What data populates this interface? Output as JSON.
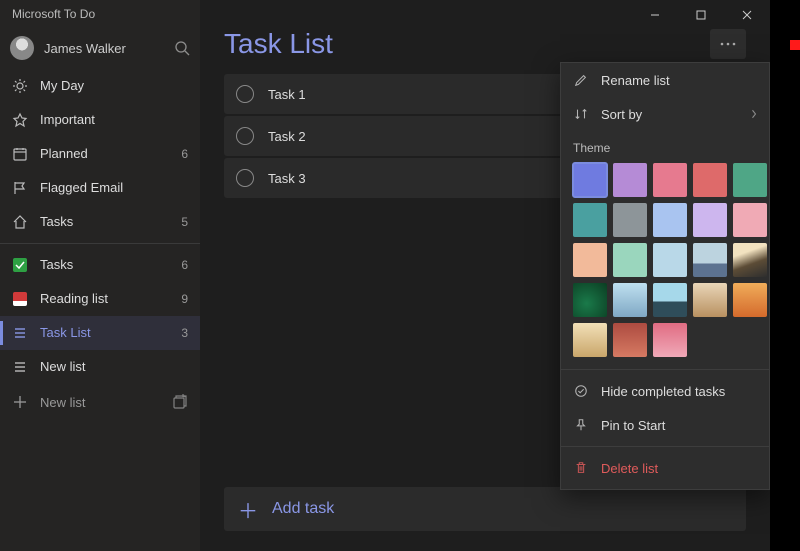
{
  "app": {
    "title": "Microsoft To Do"
  },
  "account": {
    "name": "James Walker"
  },
  "window_controls": {
    "minimize": "minimize",
    "maximize": "maximize",
    "close": "close"
  },
  "sidebar": {
    "smart_lists": [
      {
        "icon": "sun-icon",
        "label": "My Day",
        "count": ""
      },
      {
        "icon": "star-icon",
        "label": "Important",
        "count": ""
      },
      {
        "icon": "calendar-icon",
        "label": "Planned",
        "count": "6"
      },
      {
        "icon": "flag-icon",
        "label": "Flagged Email",
        "count": ""
      },
      {
        "icon": "home-icon",
        "label": "Tasks",
        "count": "5"
      }
    ],
    "user_lists": [
      {
        "icon": "green-square",
        "label": "Tasks",
        "count": "6",
        "selected": false
      },
      {
        "icon": "red-book",
        "label": "Reading list",
        "count": "9",
        "selected": false
      },
      {
        "icon": "list-icon",
        "label": "Task List",
        "count": "3",
        "selected": true
      },
      {
        "icon": "list-icon",
        "label": "New list",
        "count": "",
        "selected": false
      }
    ],
    "new_list_label": "New list"
  },
  "main": {
    "title": "Task List",
    "tasks": [
      {
        "title": "Task 1"
      },
      {
        "title": "Task 2"
      },
      {
        "title": "Task 3"
      }
    ],
    "add_task_label": "Add task"
  },
  "ctx_menu": {
    "rename_label": "Rename list",
    "sort_label": "Sort by",
    "theme_label": "Theme",
    "hide_completed_label": "Hide completed tasks",
    "pin_label": "Pin to Start",
    "delete_label": "Delete list",
    "swatches": [
      {
        "bg": "#6f7be0",
        "selected": true
      },
      {
        "bg": "#b58bd6"
      },
      {
        "bg": "#e67a8f"
      },
      {
        "bg": "#de6a6a"
      },
      {
        "bg": "#4fa686"
      },
      {
        "bg": "#4aa0a0"
      },
      {
        "bg": "#8d9599"
      },
      {
        "bg": "#a9c4f0"
      },
      {
        "bg": "#cdb6ee"
      },
      {
        "bg": "#f0aab5"
      },
      {
        "bg": "#f2ba9a"
      },
      {
        "bg": "#9ad6bd"
      },
      {
        "bg": "#b9d8e8"
      },
      {
        "bg": "linear-gradient(#bcd3df 60%,#5c7290 60%)"
      },
      {
        "bg": "linear-gradient(160deg,#f2e2c0 30%,#5c4c36 60%,#2e2e2e)"
      },
      {
        "bg": "radial-gradient(circle at 40% 60%,#1a7a4a,#0b3d22)"
      },
      {
        "bg": "linear-gradient(#bfe0f0,#7fa8c4)"
      },
      {
        "bg": "linear-gradient(#a6d8ea 55%,#2f4d5a 55%)"
      },
      {
        "bg": "linear-gradient(#e9d6b8,#b89060)"
      },
      {
        "bg": "linear-gradient(#f0ad5a,#d46a2c)"
      },
      {
        "bg": "linear-gradient(#f2e0b8,#c9a66a)"
      },
      {
        "bg": "linear-gradient(#ad4b40,#d67a63)"
      },
      {
        "bg": "linear-gradient(#e06c82,#f0a9b8)"
      }
    ]
  }
}
